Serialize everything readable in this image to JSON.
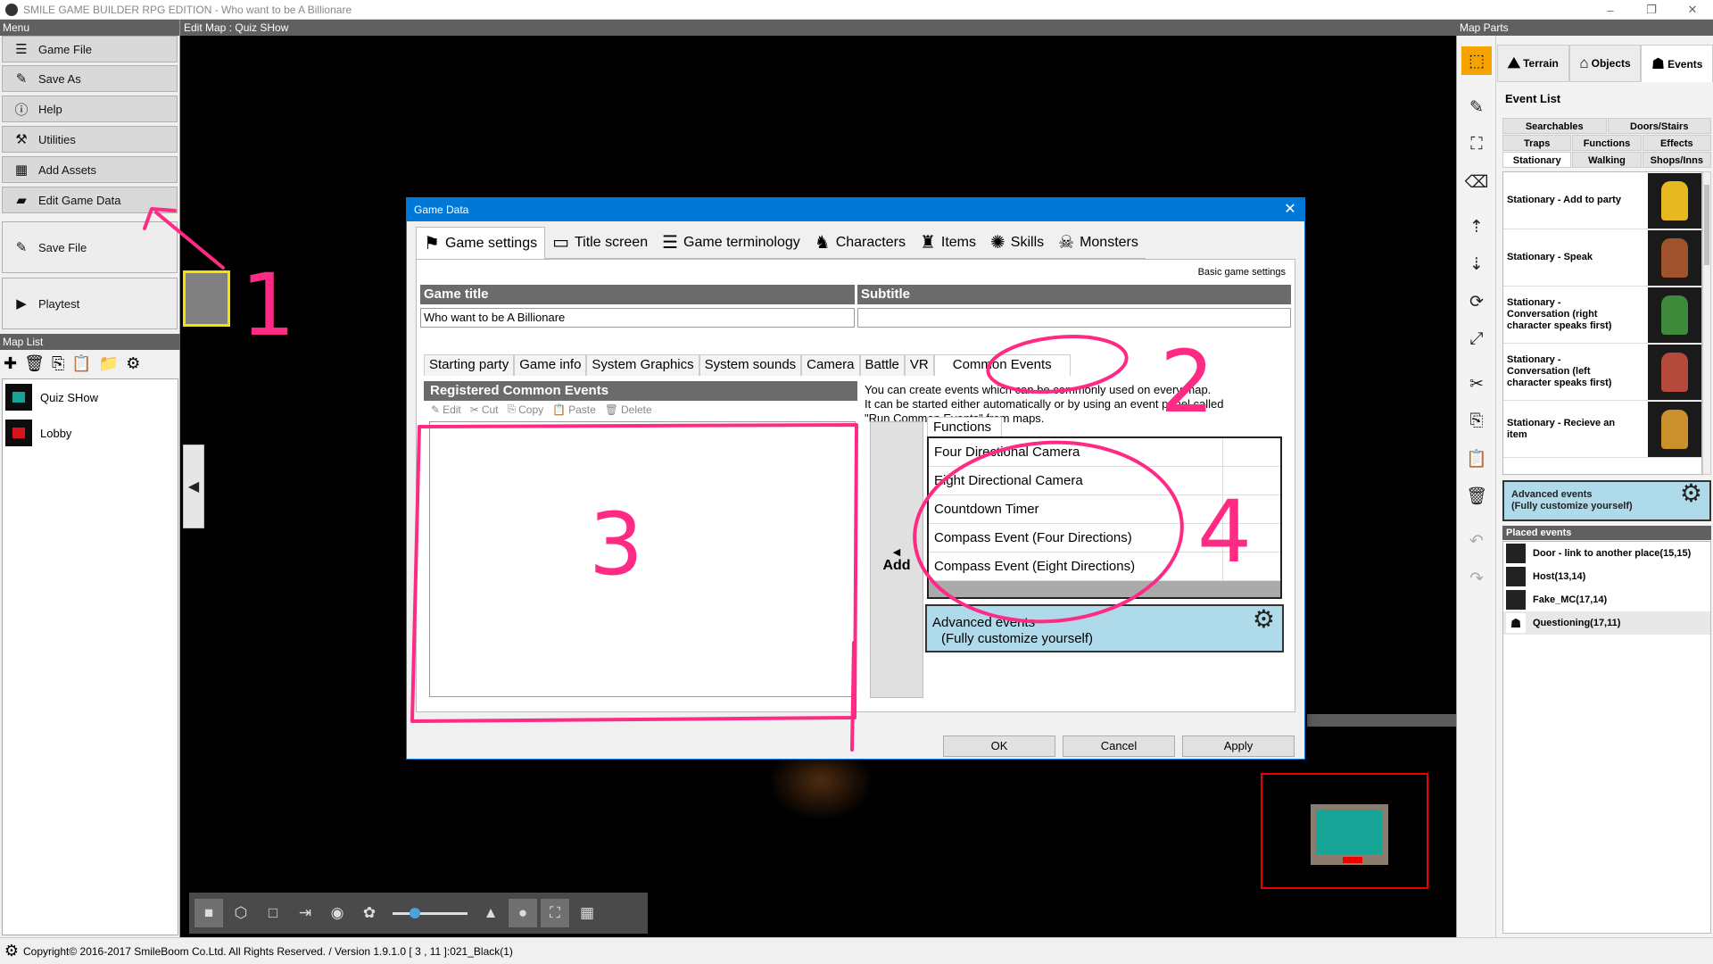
{
  "window": {
    "title": "SMILE GAME BUILDER RPG EDITION - Who want to be A Billionare",
    "controls": [
      "–",
      "❐",
      "✕"
    ]
  },
  "left_panel": {
    "menu_header": "Menu",
    "menu": [
      {
        "label": "Game File",
        "icon": "hamburger-icon"
      },
      {
        "label": "Save As",
        "icon": "save-as-icon"
      },
      {
        "label": "Help",
        "icon": "info-icon"
      },
      {
        "label": "Utilities",
        "icon": "wrench-icon"
      },
      {
        "label": "Add Assets",
        "icon": "grid-icon"
      },
      {
        "label": "Edit Game Data",
        "icon": "book-icon"
      },
      {
        "label": "Save File",
        "icon": "save-icon"
      },
      {
        "label": "Playtest",
        "icon": "play-icon"
      }
    ],
    "map_list_header": "Map List",
    "maps": [
      {
        "name": "Quiz SHow",
        "color": "#16a596"
      },
      {
        "name": "Lobby",
        "color": "#d9151b"
      }
    ]
  },
  "editor": {
    "header": "Edit Map : Quiz SHow",
    "zoom": 0.3
  },
  "right_panel": {
    "header": "Map Parts",
    "tabs": [
      "Terrain",
      "Objects",
      "Events"
    ],
    "event_list_label": "Event List",
    "categories_row1": [
      "Searchables",
      "Doors/Stairs"
    ],
    "categories_row2": [
      "Traps",
      "Functions",
      "Effects"
    ],
    "categories_row3": [
      "Stationary",
      "Walking",
      "Shops/Inns"
    ],
    "events": [
      {
        "label": "Stationary - Add to party",
        "color": "#e8b820"
      },
      {
        "label": "Stationary - Speak",
        "color": "#a0522d"
      },
      {
        "label": "Stationary - Conversation (right character speaks first)",
        "color": "#3f8a3a"
      },
      {
        "label": "Stationary - Conversation (left character speaks first)",
        "color": "#b34a3c"
      },
      {
        "label": "Stationary - Recieve an item",
        "color": "#c9902c"
      }
    ],
    "advanced_line1": "Advanced events",
    "advanced_line2": "(Fully customize yourself)",
    "placed_header": "Placed events",
    "placed": [
      "Door - link to another place(15,15)",
      "Host(13,14)",
      "Fake_MC(17,14)",
      "Questioning(17,11)"
    ]
  },
  "status_bar": "Copyright© 2016-2017 SmileBoom Co.Ltd. All Rights Reserved. / Version 1.9.1.0  [ 3 , 11 ]:021_Black(1)",
  "dialog": {
    "title": "Game Data",
    "tabs": [
      {
        "label": "Game settings",
        "icon": "flag-icon"
      },
      {
        "label": "Title screen",
        "icon": "screen-icon"
      },
      {
        "label": "Game terminology",
        "icon": "list-icon"
      },
      {
        "label": "Characters",
        "icon": "characters-icon"
      },
      {
        "label": "Items",
        "icon": "items-icon"
      },
      {
        "label": "Skills",
        "icon": "skills-icon"
      },
      {
        "label": "Monsters",
        "icon": "monster-icon"
      }
    ],
    "basic_label": "Basic game settings",
    "game_title_label": "Game title",
    "game_title_value": "Who want to be A Billionare",
    "subtitle_label": "Subtitle",
    "subtitle_value": "",
    "sub_tabs": [
      "Starting party",
      "Game info",
      "System Graphics",
      "System sounds",
      "Camera",
      "Battle",
      "VR",
      "Common Events"
    ],
    "registered_header": "Registered Common Events",
    "reg_tools": [
      "Edit",
      "Cut",
      "Copy",
      "Paste",
      "Delete"
    ],
    "description": [
      "You can create events which can be commonly used on every map.",
      "It can be started either automatically or by using an event panel called",
      "\"Run Common Events\" from maps."
    ],
    "add_label": "Add",
    "functions_tab": "Functions",
    "functions": [
      "Four Directional Camera",
      "Eight Directional Camera",
      "Countdown Timer",
      "Compass Event (Four Directions)",
      "Compass Event (Eight Directions)"
    ],
    "advanced_line1": "Advanced events",
    "advanced_line2": "(Fully customize yourself)",
    "buttons": [
      "OK",
      "Cancel",
      "Apply"
    ]
  },
  "annotations": [
    "1",
    "2",
    "3",
    "4"
  ],
  "colors": {
    "annotation": "#ff2a84",
    "accent": "#0078d7",
    "tool_selected": "#f5a300"
  }
}
